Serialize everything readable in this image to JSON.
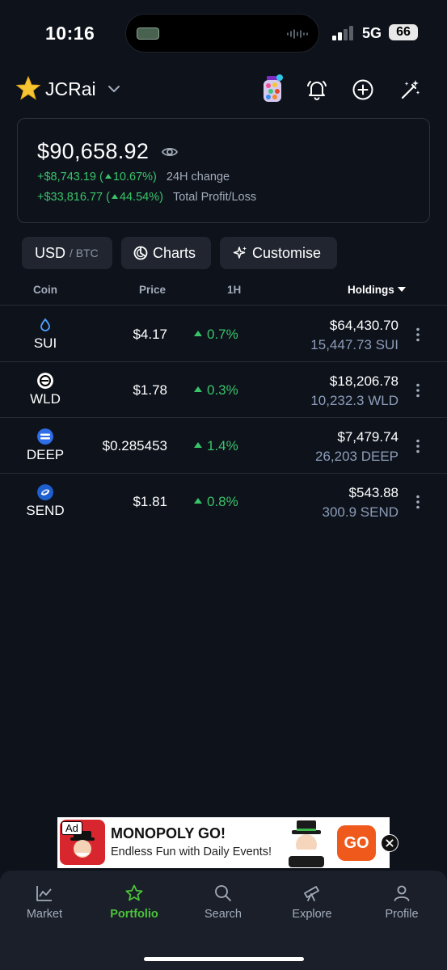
{
  "status_bar": {
    "time": "10:16",
    "network": "5G",
    "battery": "66"
  },
  "header": {
    "account_name": "JCRai"
  },
  "balance": {
    "total": "$90,658.92",
    "change_24h_value": "+$8,743.19",
    "change_24h_pct": "10.67%",
    "change_24h_label": "24H change",
    "pnl_value": "+$33,816.77",
    "pnl_pct": "44.54%",
    "pnl_label": "Total Profit/Loss"
  },
  "toggles": {
    "currency_main": "USD",
    "currency_sep": "/ BTC",
    "charts_label": "Charts",
    "customise_label": "Customise"
  },
  "table": {
    "headers": {
      "coin": "Coin",
      "price": "Price",
      "change": "1H",
      "holdings": "Holdings"
    },
    "rows": [
      {
        "symbol": "SUI",
        "price": "$4.17",
        "change": "0.7%",
        "holding_value": "$64,430.70",
        "holding_qty": "15,447.73 SUI"
      },
      {
        "symbol": "WLD",
        "price": "$1.78",
        "change": "0.3%",
        "holding_value": "$18,206.78",
        "holding_qty": "10,232.3 WLD"
      },
      {
        "symbol": "DEEP",
        "price": "$0.285453",
        "change": "1.4%",
        "holding_value": "$7,479.74",
        "holding_qty": "26,203 DEEP"
      },
      {
        "symbol": "SEND",
        "price": "$1.81",
        "change": "0.8%",
        "holding_value": "$543.88",
        "holding_qty": "300.9 SEND"
      }
    ]
  },
  "ad": {
    "tag": "Ad",
    "title": "MONOPOLY GO!",
    "description": "Endless Fun with Daily Events!",
    "cta": "GO"
  },
  "nav": {
    "items": [
      {
        "label": "Market",
        "icon": "market-chart-icon"
      },
      {
        "label": "Portfolio",
        "icon": "star-icon",
        "active": true
      },
      {
        "label": "Search",
        "icon": "search-icon"
      },
      {
        "label": "Explore",
        "icon": "telescope-icon"
      },
      {
        "label": "Profile",
        "icon": "user-icon"
      }
    ]
  },
  "colors": {
    "background": "#0e121b",
    "positive": "#39c46a",
    "nav_active": "#4cc23a",
    "muted": "#a3acbb"
  }
}
